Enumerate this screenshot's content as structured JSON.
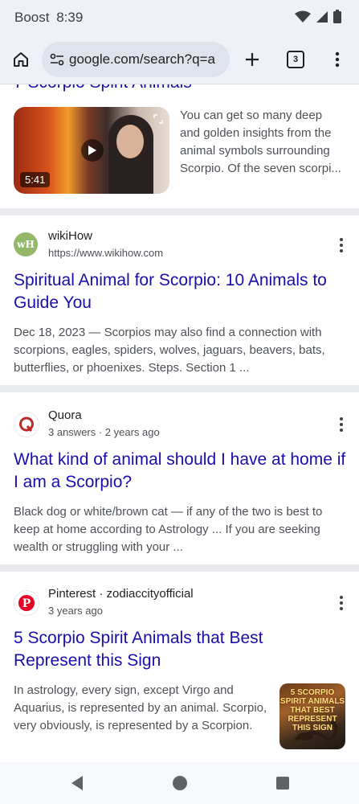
{
  "status_bar": {
    "carrier": "Boost",
    "time": "8:39"
  },
  "toolbar": {
    "url": "google.com/search?q=a",
    "tab_count": "3"
  },
  "video_result": {
    "title_partial": "7 Scorpio Spirit Animals",
    "duration": "5:41",
    "snippet": "You can get so many deep and golden insights from the animal symbols surrounding Scorpio. Of the seven scorpi..."
  },
  "results": [
    {
      "site": "wikiHow",
      "sub": "https://www.wikihow.com",
      "favicon_text": "wH",
      "title": "Spiritual Animal for Scorpio: 10 Animals to Guide You",
      "snippet": "Dec 18, 2023 — Scorpios may also find a connection with scorpions, eagles, spiders, wolves, jaguars, beavers, bats, butterflies, or phoenixes. Steps. Section 1 ..."
    },
    {
      "site": "Quora",
      "sub": "3 answers · 2 years ago",
      "title": "What kind of animal should I have at home if I am a Scorpio?",
      "snippet": "Black dog or white/brown cat — if any of the two is best to keep at home according to Astrology ... If you are seeking wealth or struggling with your ..."
    },
    {
      "site": "Pinterest · zodiaccityofficial",
      "sub": "3 years ago",
      "title": "5 Scorpio Spirit Animals that Best Represent this Sign",
      "snippet": "In astrology, every sign, except Virgo and Aquarius, is represented by an animal. Scorpio, very obviously, is represented by a Scorpion.",
      "thumb_text": "5 SCORPIO SPIRIT ANIMALS THAT BEST REPRESENT THIS SIGN"
    }
  ],
  "colors": {
    "link": "#1a0dab",
    "snippet": "#4d5156",
    "chrome_bg": "#eef1f8",
    "divider": "#e8eaed"
  },
  "icons": [
    "wifi-icon",
    "signal-icon",
    "battery-icon",
    "home-icon",
    "site-info-icon",
    "new-tab-icon",
    "tab-switcher-icon",
    "menu-icon",
    "play-icon",
    "expand-icon",
    "back-icon",
    "home-nav-icon",
    "recents-icon"
  ]
}
